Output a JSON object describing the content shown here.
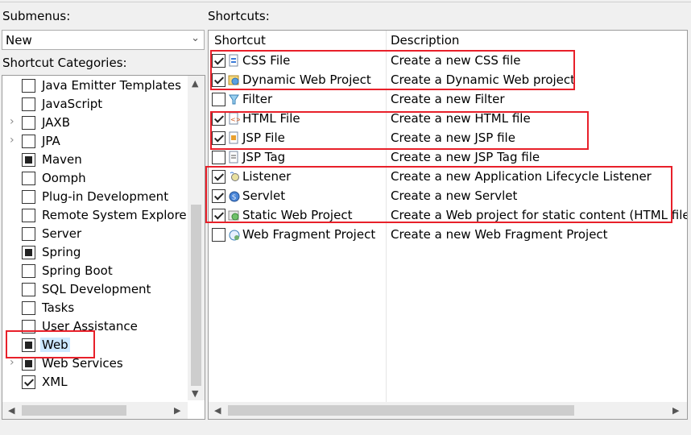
{
  "submenus": {
    "label": "Submenus:",
    "selected": "New"
  },
  "categories": {
    "label": "Shortcut Categories:",
    "items": [
      {
        "label": "Java Emitter Templates",
        "state": "unchecked",
        "expandable": false
      },
      {
        "label": "JavaScript",
        "state": "unchecked",
        "expandable": false
      },
      {
        "label": "JAXB",
        "state": "unchecked",
        "expandable": true
      },
      {
        "label": "JPA",
        "state": "unchecked",
        "expandable": true
      },
      {
        "label": "Maven",
        "state": "partial",
        "expandable": false
      },
      {
        "label": "Oomph",
        "state": "unchecked",
        "expandable": false
      },
      {
        "label": "Plug-in Development",
        "state": "unchecked",
        "expandable": false
      },
      {
        "label": "Remote System Explorer",
        "state": "unchecked",
        "expandable": false
      },
      {
        "label": "Server",
        "state": "unchecked",
        "expandable": false
      },
      {
        "label": "Spring",
        "state": "partial",
        "expandable": false
      },
      {
        "label": "Spring Boot",
        "state": "unchecked",
        "expandable": false
      },
      {
        "label": "SQL Development",
        "state": "unchecked",
        "expandable": false
      },
      {
        "label": "Tasks",
        "state": "unchecked",
        "expandable": false
      },
      {
        "label": "User Assistance",
        "state": "unchecked",
        "expandable": false
      },
      {
        "label": "Web",
        "state": "partial",
        "expandable": false,
        "selected": true
      },
      {
        "label": "Web Services",
        "state": "partial",
        "expandable": true
      },
      {
        "label": "XML",
        "state": "checked",
        "expandable": false
      }
    ]
  },
  "shortcuts": {
    "label": "Shortcuts:",
    "col_shortcut": "Shortcut",
    "col_description": "Description",
    "items": [
      {
        "name": "CSS File",
        "desc": "Create a new CSS file",
        "checked": true,
        "icon": "css-file-icon"
      },
      {
        "name": "Dynamic Web Project",
        "desc": "Create a Dynamic Web project",
        "checked": true,
        "icon": "web-project-icon"
      },
      {
        "name": "Filter",
        "desc": "Create a new Filter",
        "checked": false,
        "icon": "filter-icon"
      },
      {
        "name": "HTML File",
        "desc": "Create a new HTML file",
        "checked": true,
        "icon": "html-file-icon"
      },
      {
        "name": "JSP File",
        "desc": "Create a new JSP file",
        "checked": true,
        "icon": "jsp-file-icon"
      },
      {
        "name": "JSP Tag",
        "desc": "Create a new JSP Tag file",
        "checked": false,
        "icon": "jsp-tag-icon"
      },
      {
        "name": "Listener",
        "desc": "Create a new Application Lifecycle Listener",
        "checked": true,
        "icon": "listener-icon"
      },
      {
        "name": "Servlet",
        "desc": "Create a new Servlet",
        "checked": true,
        "icon": "servlet-icon"
      },
      {
        "name": "Static Web Project",
        "desc": "Create a Web project for static content (HTML files)",
        "checked": true,
        "icon": "static-web-project-icon"
      },
      {
        "name": "Web Fragment Project",
        "desc": "Create a new Web Fragment Project",
        "checked": false,
        "icon": "web-fragment-project-icon"
      }
    ]
  },
  "colors": {
    "highlight_box": "#e8202a",
    "selection": "#cce8ff"
  }
}
